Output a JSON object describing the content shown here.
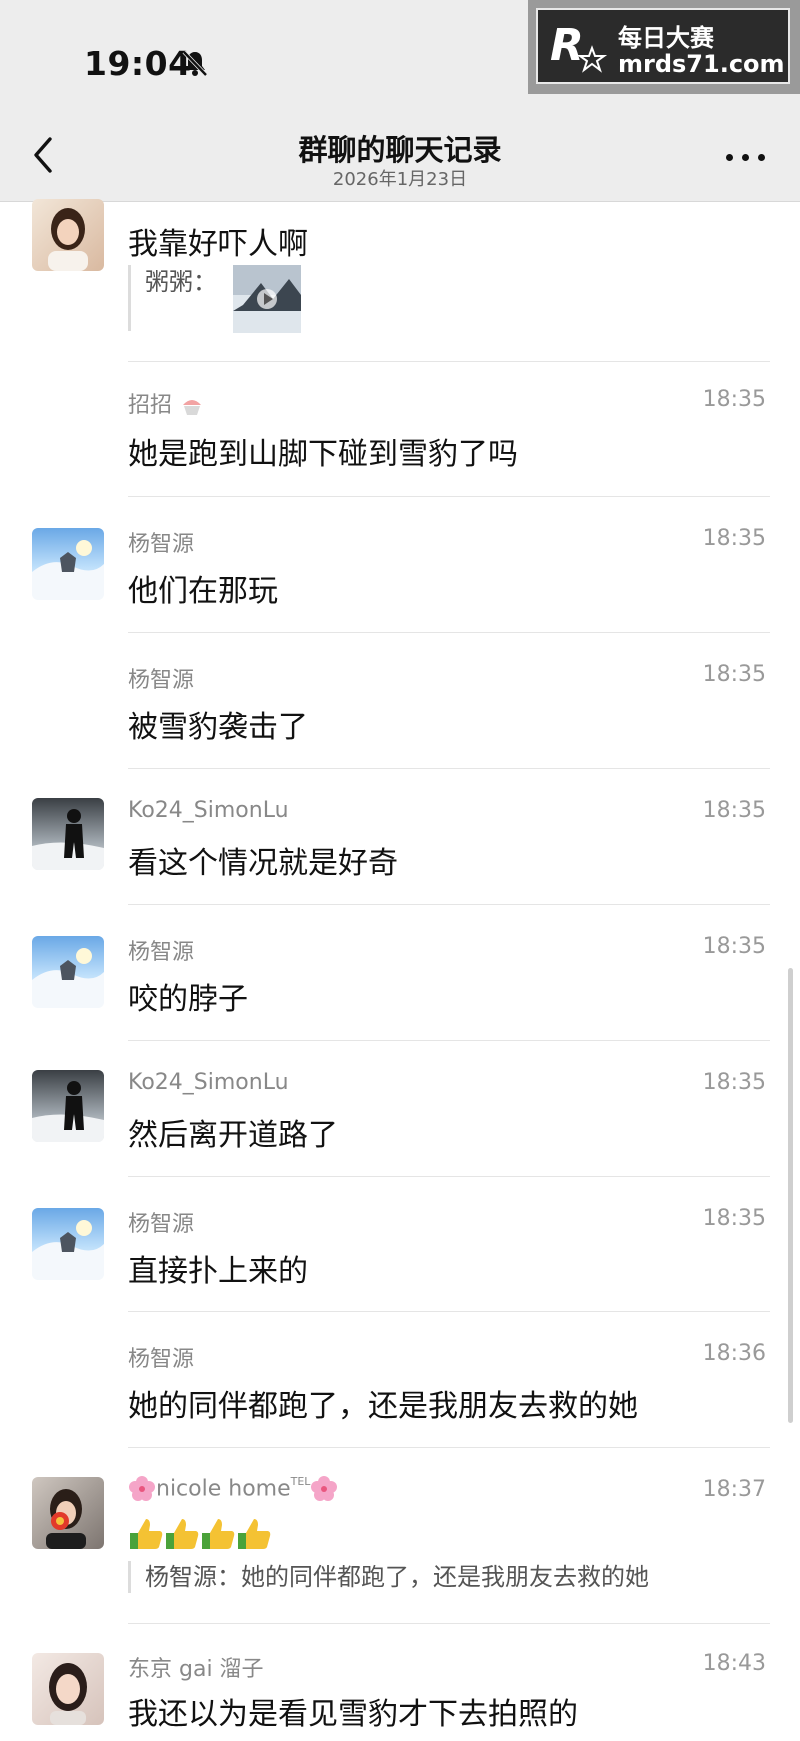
{
  "status": {
    "time": "19:04"
  },
  "watermark": {
    "title": "每日大赛",
    "url": "mrds71.com"
  },
  "nav": {
    "title": "群聊的聊天记录",
    "date": "2026年1月23日"
  },
  "messages": [
    {
      "name": "招招",
      "time": "",
      "text": "我靠好吓人啊",
      "quote_name": "粥粥：",
      "avatar": "woman-photo"
    },
    {
      "name": "招招",
      "time": "18:35",
      "text": "她是跑到山脚下碰到雪豹了吗"
    },
    {
      "name": "杨智源",
      "time": "18:35",
      "text": "他们在那玩",
      "avatar": "snow-scene"
    },
    {
      "name": "杨智源",
      "time": "18:35",
      "text": "被雪豹袭击了"
    },
    {
      "name": "Ko24_SimonLu",
      "time": "18:35",
      "text": "看这个情况就是好奇",
      "avatar": "dark-figure"
    },
    {
      "name": "杨智源",
      "time": "18:35",
      "text": "咬的脖子",
      "avatar": "snow-scene"
    },
    {
      "name": "Ko24_SimonLu",
      "time": "18:35",
      "text": "然后离开道路了",
      "avatar": "dark-figure"
    },
    {
      "name": "杨智源",
      "time": "18:35",
      "text": "直接扑上来的",
      "avatar": "snow-scene"
    },
    {
      "name": "杨智源",
      "time": "18:36",
      "text": "她的同伴都跑了，还是我朋友去救的她"
    },
    {
      "name": "nicole home",
      "name_sup": "TEL",
      "time": "18:37",
      "text": "",
      "quote": "杨智源：她的同伴都跑了，还是我朋友去救的她",
      "avatar": "woman-flower"
    },
    {
      "name": "东京 gai 溜子",
      "time": "18:43",
      "text": "我还以为是看见雪豹才下去拍照的",
      "avatar": "woman-portrait"
    }
  ],
  "colors": {
    "nav_bg": "#ededed",
    "divider": "#e5e5e5",
    "name": "#888888"
  }
}
